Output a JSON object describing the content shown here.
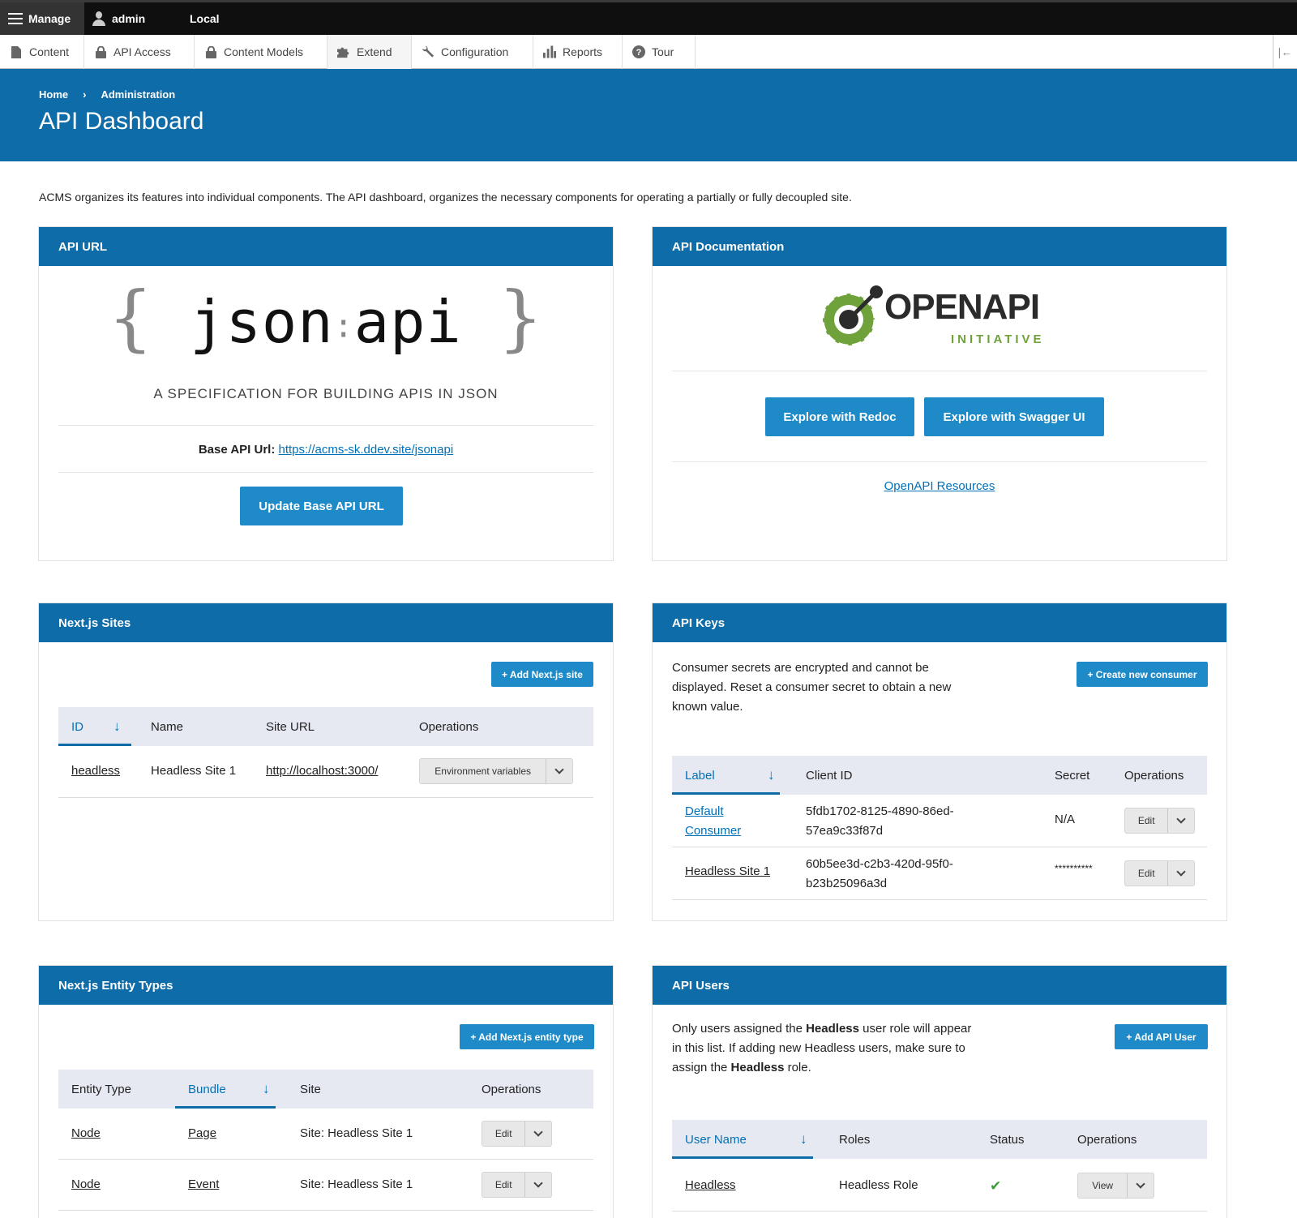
{
  "toolbar": {
    "manage_label": "Manage",
    "user_label": "admin",
    "env_label": "Local"
  },
  "tray": {
    "items": [
      {
        "label": "Content",
        "icon": "file-icon"
      },
      {
        "label": "API Access",
        "icon": "lock-icon"
      },
      {
        "label": "Content Models",
        "icon": "lock-icon"
      },
      {
        "label": "Extend",
        "icon": "puzzle-icon"
      },
      {
        "label": "Configuration",
        "icon": "wrench-icon"
      },
      {
        "label": "Reports",
        "icon": "bar-chart-icon"
      },
      {
        "label": "Tour",
        "icon": "question-icon"
      }
    ]
  },
  "header": {
    "breadcrumb": [
      "Home",
      "Administration"
    ],
    "breadcrumb_sep": "›",
    "title": "API Dashboard"
  },
  "intro": "ACMS organizes its features into individual components. The API dashboard, organizes the necessary components for operating a partially or fully decoupled site.",
  "api_url": {
    "title": "API URL",
    "logo_text_left": "json",
    "logo_text_right": "api",
    "tagline": "A SPECIFICATION FOR BUILDING APIS IN JSON",
    "base_label": "Base API Url:",
    "base_url": "https://acms-sk.ddev.site/jsonapi",
    "update_button": "Update Base API URL"
  },
  "api_docs": {
    "title": "API Documentation",
    "logo_word": "OPENAPI",
    "logo_sub": "INITIATIVE",
    "redoc_button": "Explore with Redoc",
    "swagger_button": "Explore with Swagger UI",
    "resources_link": "OpenAPI Resources"
  },
  "nextjs_sites": {
    "title": "Next.js Sites",
    "add_button": "+ Add Next.js site",
    "columns": [
      "ID",
      "Name",
      "Site URL",
      "Operations"
    ],
    "rows": [
      {
        "id": "headless",
        "name": "Headless Site 1",
        "url": "http://localhost:3000/",
        "op": "Environment variables"
      }
    ]
  },
  "api_keys": {
    "title": "API Keys",
    "description": "Consumer secrets are encrypted and cannot be displayed. Reset a consumer secret to obtain a new known value.",
    "create_button": "+ Create new consumer",
    "columns": [
      "Label",
      "Client ID",
      "Secret",
      "Operations"
    ],
    "rows": [
      {
        "label_1": "Default",
        "label_2": "Consumer",
        "client_1": "5fdb1702-8125-4890-86ed-",
        "client_2": "57ea9c33f87d",
        "secret": "N/A",
        "op": "Edit"
      },
      {
        "label_1": "Headless Site 1",
        "label_2": "",
        "client_1": "60b5ee3d-c2b3-420d-95f0-",
        "client_2": "b23b25096a3d",
        "secret": "**********",
        "op": "Edit"
      }
    ]
  },
  "entity_types": {
    "title": "Next.js Entity Types",
    "add_button": "+ Add Next.js entity type",
    "columns": [
      "Entity Type",
      "Bundle",
      "Site",
      "Operations"
    ],
    "rows": [
      {
        "entity": "Node",
        "bundle": "Page",
        "site": "Site: Headless Site 1",
        "op": "Edit"
      },
      {
        "entity": "Node",
        "bundle": "Event",
        "site": "Site: Headless Site 1",
        "op": "Edit"
      }
    ]
  },
  "api_users": {
    "title": "API Users",
    "desc_line1_a": "Only users assigned the ",
    "desc_line1_b": "Headless",
    "desc_line1_c": " user role will appear",
    "desc_line2": "in this list. If adding new Headless users, make sure to",
    "desc_line3_a": "assign the ",
    "desc_line3_b": "Headless",
    "desc_line3_c": " role.",
    "add_button": "+ Add API User",
    "columns": [
      "User Name",
      "Roles",
      "Status",
      "Operations"
    ],
    "rows": [
      {
        "user": "Headless",
        "role": "Headless Role",
        "status": "✔",
        "op": "View"
      }
    ]
  },
  "colors": {
    "brand_blue": "#0e6ca9",
    "button_blue": "#1e8ac8",
    "link_blue": "#0071b8",
    "table_head": "#e6e9f2",
    "status_green": "#3a9d3a"
  }
}
